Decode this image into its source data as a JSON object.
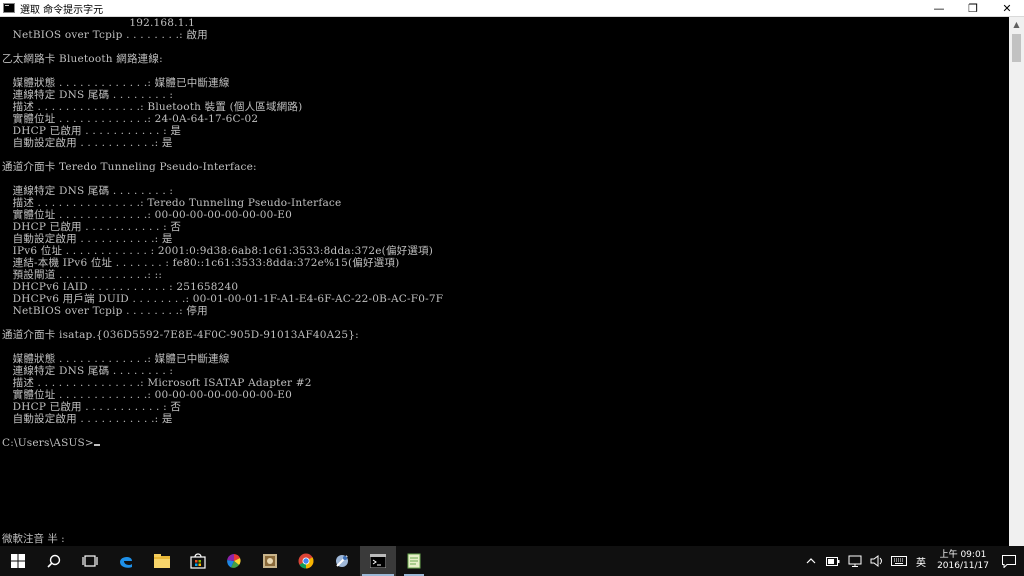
{
  "window": {
    "title": "選取 命令提示字元",
    "minimize": "—",
    "maximize": "❐",
    "close": "✕"
  },
  "console": {
    "lines": [
      "                                    192.168.1.1",
      "   NetBIOS over Tcpip . . . . . . . .: 啟用",
      "",
      "乙太網路卡 Bluetooth 網路連線:",
      "",
      "   媒體狀態 . . . . . . . . . . . . .: 媒體已中斷連線",
      "   連線特定 DNS 尾碼 . . . . . . . . :",
      "   描述 . . . . . . . . . . . . . . .: Bluetooth 裝置 (個人區域網路)",
      "   實體位址 . . . . . . . . . . . . .: 24-0A-64-17-6C-02",
      "   DHCP 已啟用 . . . . . . . . . . . : 是",
      "   自動設定啟用 . . . . . . . . . . .: 是",
      "",
      "通道介面卡 Teredo Tunneling Pseudo-Interface:",
      "",
      "   連線特定 DNS 尾碼 . . . . . . . . :",
      "   描述 . . . . . . . . . . . . . . .: Teredo Tunneling Pseudo-Interface",
      "   實體位址 . . . . . . . . . . . . .: 00-00-00-00-00-00-00-E0",
      "   DHCP 已啟用 . . . . . . . . . . . : 否",
      "   自動設定啟用 . . . . . . . . . . .: 是",
      "   IPv6 位址 . . . . . . . . . . . . : 2001:0:9d38:6ab8:1c61:3533:8dda:372e(偏好選項)",
      "   連結-本機 IPv6 位址 . . . . . . . : fe80::1c61:3533:8dda:372e%15(偏好選項)",
      "   預設閘道 . . . . . . . . . . . . .: ::",
      "   DHCPv6 IAID . . . . . . . . . . . : 251658240",
      "   DHCPv6 用戶端 DUID . . . . . . . .: 00-01-00-01-1F-A1-E4-6F-AC-22-0B-AC-F0-7F",
      "   NetBIOS over Tcpip . . . . . . . .: 停用",
      "",
      "通道介面卡 isatap.{036D5592-7E8E-4F0C-905D-91013AF40A25}:",
      "",
      "   媒體狀態 . . . . . . . . . . . . .: 媒體已中斷連線",
      "   連線特定 DNS 尾碼 . . . . . . . . :",
      "   描述 . . . . . . . . . . . . . . .: Microsoft ISATAP Adapter #2",
      "   實體位址 . . . . . . . . . . . . .: 00-00-00-00-00-00-00-E0",
      "   DHCP 已啟用 . . . . . . . . . . . : 否",
      "   自動設定啟用 . . . . . . . . . . .: 是",
      "",
      "C:\\Users\\ASUS>"
    ],
    "ime_status": "微軟注音 半 :"
  },
  "taskbar": {
    "apps": [
      {
        "name": "start-button",
        "icon": "windows-logo-icon"
      },
      {
        "name": "search-button",
        "icon": "search-icon"
      },
      {
        "name": "task-view-button",
        "icon": "task-view-icon"
      },
      {
        "name": "edge-button",
        "icon": "edge-icon"
      },
      {
        "name": "file-explorer-button",
        "icon": "folder-icon"
      },
      {
        "name": "store-button",
        "icon": "store-icon"
      },
      {
        "name": "picasa-button",
        "icon": "pinwheel-icon"
      },
      {
        "name": "app-photo-button",
        "icon": "photo-app-icon"
      },
      {
        "name": "chrome-button",
        "icon": "chrome-icon"
      },
      {
        "name": "app-tool-button",
        "icon": "tool-app-icon"
      },
      {
        "name": "cmd-button",
        "icon": "cmd-icon"
      },
      {
        "name": "notepad-button",
        "icon": "notepad-icon"
      }
    ],
    "language": "英",
    "clock_time": "上午 09:01",
    "clock_date": "2016/11/17"
  },
  "colors": {
    "console_bg": "#000000",
    "console_text": "#c0c0c0",
    "taskbar_bg": "#101010",
    "accent": "#9bb8d6"
  }
}
